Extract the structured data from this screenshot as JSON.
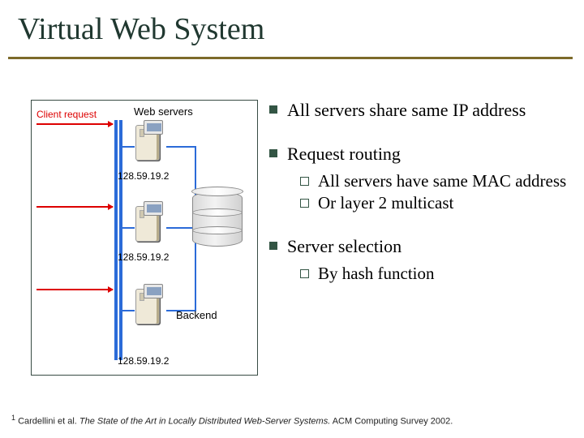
{
  "title": "Virtual Web System",
  "diagram": {
    "client_label": "Client request",
    "webservers_label": "Web servers",
    "backend_label": "Backend",
    "ips": [
      "128.59.19.2",
      "128.59.19.2",
      "128.59.19.2"
    ]
  },
  "bullets": {
    "b1": "All servers share same IP address",
    "b2": "Request routing",
    "b2s1": "All servers have same MAC address",
    "b2s2": "Or layer 2 multicast",
    "b3": "Server selection",
    "b3s1": "By hash function"
  },
  "footnote": {
    "marker": "1",
    "authors": "Cardellini et al.",
    "title_italic": "The State of the Art in Locally Distributed Web-Server Systems.",
    "venue": "ACM Computing Survey 2002."
  }
}
